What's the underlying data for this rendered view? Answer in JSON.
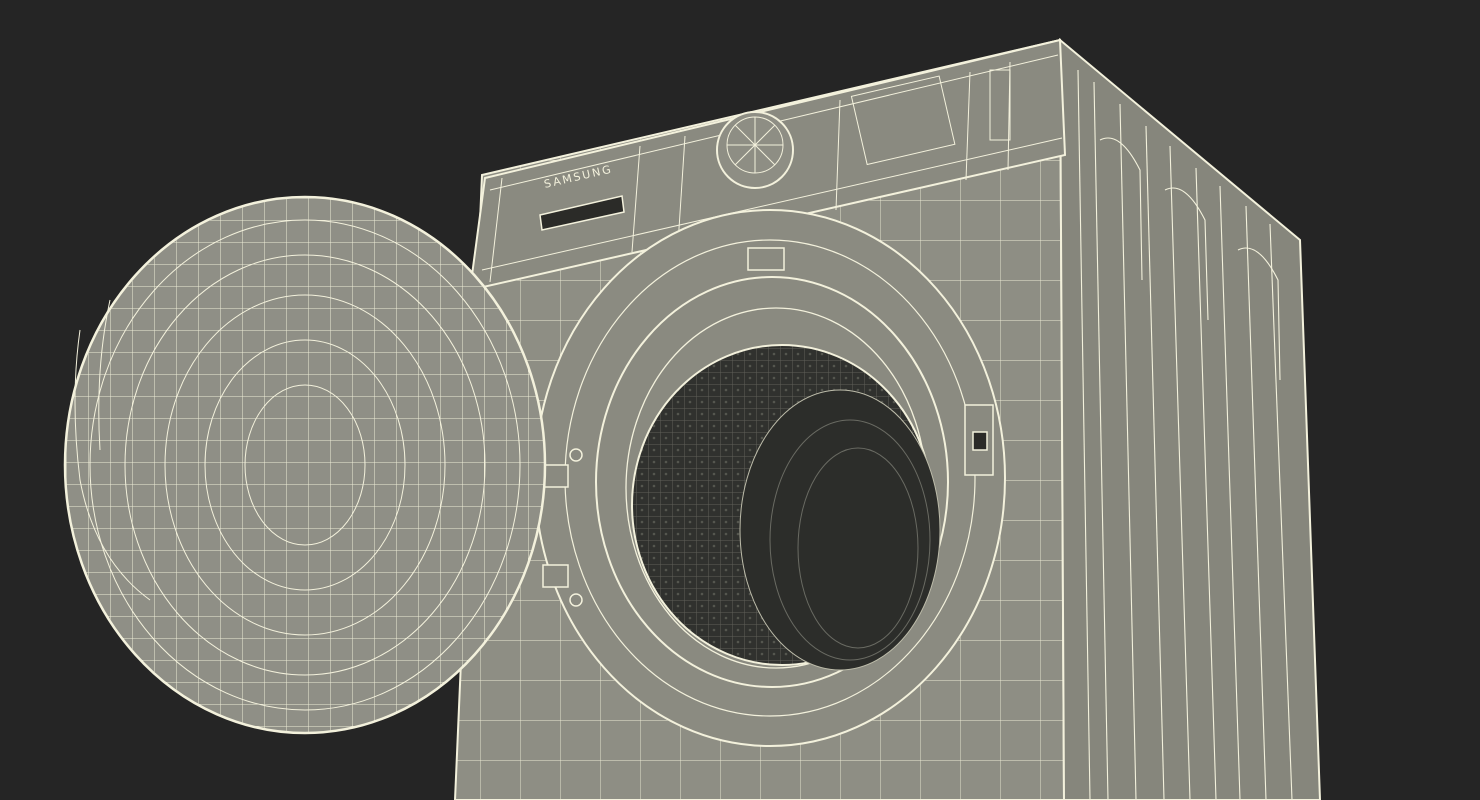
{
  "brand_label": "SAMSUNG",
  "colors": {
    "background": "#252525",
    "body_fill": "#8f8f85",
    "body_fill_dark": "#7a7a71",
    "side_fill": "#86867c",
    "wire": "#f3f1dc",
    "drum_dark": "#2f302d",
    "drum_mid": "#3c3d39"
  }
}
